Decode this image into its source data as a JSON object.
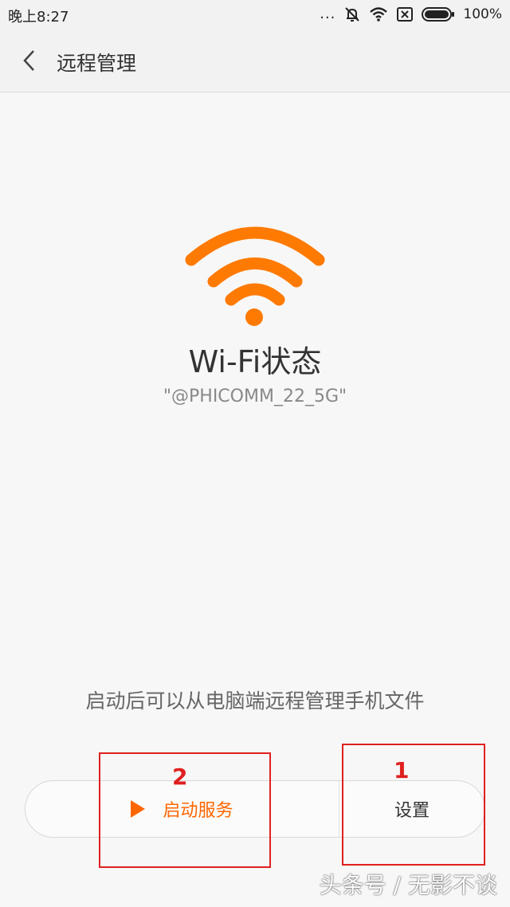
{
  "status_bar": {
    "time": "晚上8:27",
    "more": "...",
    "battery": "100%"
  },
  "title_bar": {
    "title": "远程管理"
  },
  "wifi": {
    "title": "Wi-Fi状态",
    "ssid": "\"@PHICOMM_22_5G\"",
    "color": "#ff7a00"
  },
  "hint": "启动后可以从电脑端远程管理手机文件",
  "buttons": {
    "start_label": "启动服务",
    "settings_label": "设置",
    "accent": "#ff6600"
  },
  "annotations": {
    "first": "1",
    "second": "2",
    "color": "#e02020"
  },
  "watermark": "头条号 / 无影不谈"
}
